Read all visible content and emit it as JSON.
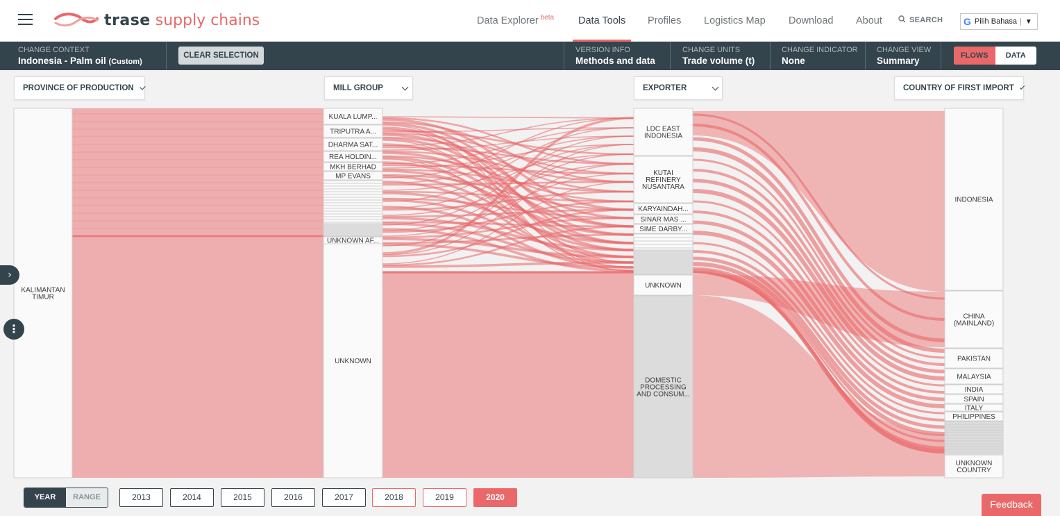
{
  "nav": {
    "brand": "trase",
    "brand_sub": "supply chains",
    "links": [
      {
        "label": "Data Explorer",
        "badge": "beta",
        "active": false
      },
      {
        "label": "Data Tools",
        "badge": "",
        "active": true
      },
      {
        "label": "Profiles",
        "badge": "",
        "active": false
      },
      {
        "label": "Logistics Map",
        "badge": "",
        "active": false
      },
      {
        "label": "Download",
        "badge": "",
        "active": false
      },
      {
        "label": "About",
        "badge": "",
        "active": false
      }
    ],
    "search_label": "SEARCH",
    "language_label": "Pilih Bahasa"
  },
  "context_bar": {
    "context_label": "CHANGE CONTEXT",
    "context_value": "Indonesia - Palm oil",
    "context_custom": "(Custom)",
    "clear_selection": "CLEAR SELECTION",
    "version_label": "VERSION INFO",
    "version_value": "Methods and data",
    "units_label": "CHANGE UNITS",
    "units_value": "Trade volume (t)",
    "indicator_label": "CHANGE INDICATOR",
    "indicator_value": "None",
    "view_label": "CHANGE VIEW",
    "view_value": "Summary",
    "toggle_flows": "FLOWS",
    "toggle_data": "DATA"
  },
  "columns": [
    {
      "label": "PROVINCE OF PRODUCTION"
    },
    {
      "label": "MILL GROUP"
    },
    {
      "label": "EXPORTER"
    },
    {
      "label": "COUNTRY OF FIRST IMPORT"
    }
  ],
  "sankey": {
    "flow_color": "#ea6869",
    "province_nodes": [
      {
        "label": [
          "KALIMANTAN",
          "TIMUR"
        ]
      }
    ],
    "mill_nodes": [
      {
        "label": [
          "KUALA LUMP..."
        ]
      },
      {
        "label": [
          "TRIPUTRA A..."
        ]
      },
      {
        "label": [
          "DHARMA SAT..."
        ]
      },
      {
        "label": [
          "REA HOLDIN..."
        ]
      },
      {
        "label": [
          "MKH BERHAD"
        ]
      },
      {
        "label": [
          "MP EVANS"
        ]
      },
      {
        "label": [
          "UNKNOWN AF..."
        ]
      },
      {
        "label": [
          "UNKNOWN"
        ]
      }
    ],
    "exporter_nodes": [
      {
        "label": [
          "LDC EAST",
          "INDONESIA"
        ]
      },
      {
        "label": [
          "KUTAI",
          "REFINERY",
          "NUSANTARA"
        ]
      },
      {
        "label": [
          "KARYAINDAH..."
        ]
      },
      {
        "label": [
          "SINAR MAS ..."
        ]
      },
      {
        "label": [
          "SIME DARBY..."
        ]
      },
      {
        "label": [
          "UNKNOWN"
        ]
      },
      {
        "label": [
          "DOMESTIC",
          "PROCESSING",
          "AND CONSUM..."
        ]
      }
    ],
    "country_nodes": [
      {
        "label": [
          "INDONESIA"
        ]
      },
      {
        "label": [
          "CHINA",
          "(MAINLAND)"
        ]
      },
      {
        "label": [
          "PAKISTAN"
        ]
      },
      {
        "label": [
          "MALAYSIA"
        ]
      },
      {
        "label": [
          "INDIA"
        ]
      },
      {
        "label": [
          "SPAIN"
        ]
      },
      {
        "label": [
          "ITALY"
        ]
      },
      {
        "label": [
          "PHILIPPINES"
        ]
      },
      {
        "label": [
          "UNKNOWN",
          "COUNTRY"
        ]
      }
    ]
  },
  "years": {
    "mode_year": "YEAR",
    "mode_range": "RANGE",
    "list": [
      {
        "label": "2013",
        "state": "normal"
      },
      {
        "label": "2014",
        "state": "normal"
      },
      {
        "label": "2015",
        "state": "normal"
      },
      {
        "label": "2016",
        "state": "normal"
      },
      {
        "label": "2017",
        "state": "normal"
      },
      {
        "label": "2018",
        "state": "available"
      },
      {
        "label": "2019",
        "state": "available"
      },
      {
        "label": "2020",
        "state": "selected"
      }
    ]
  },
  "feedback": "Feedback"
}
